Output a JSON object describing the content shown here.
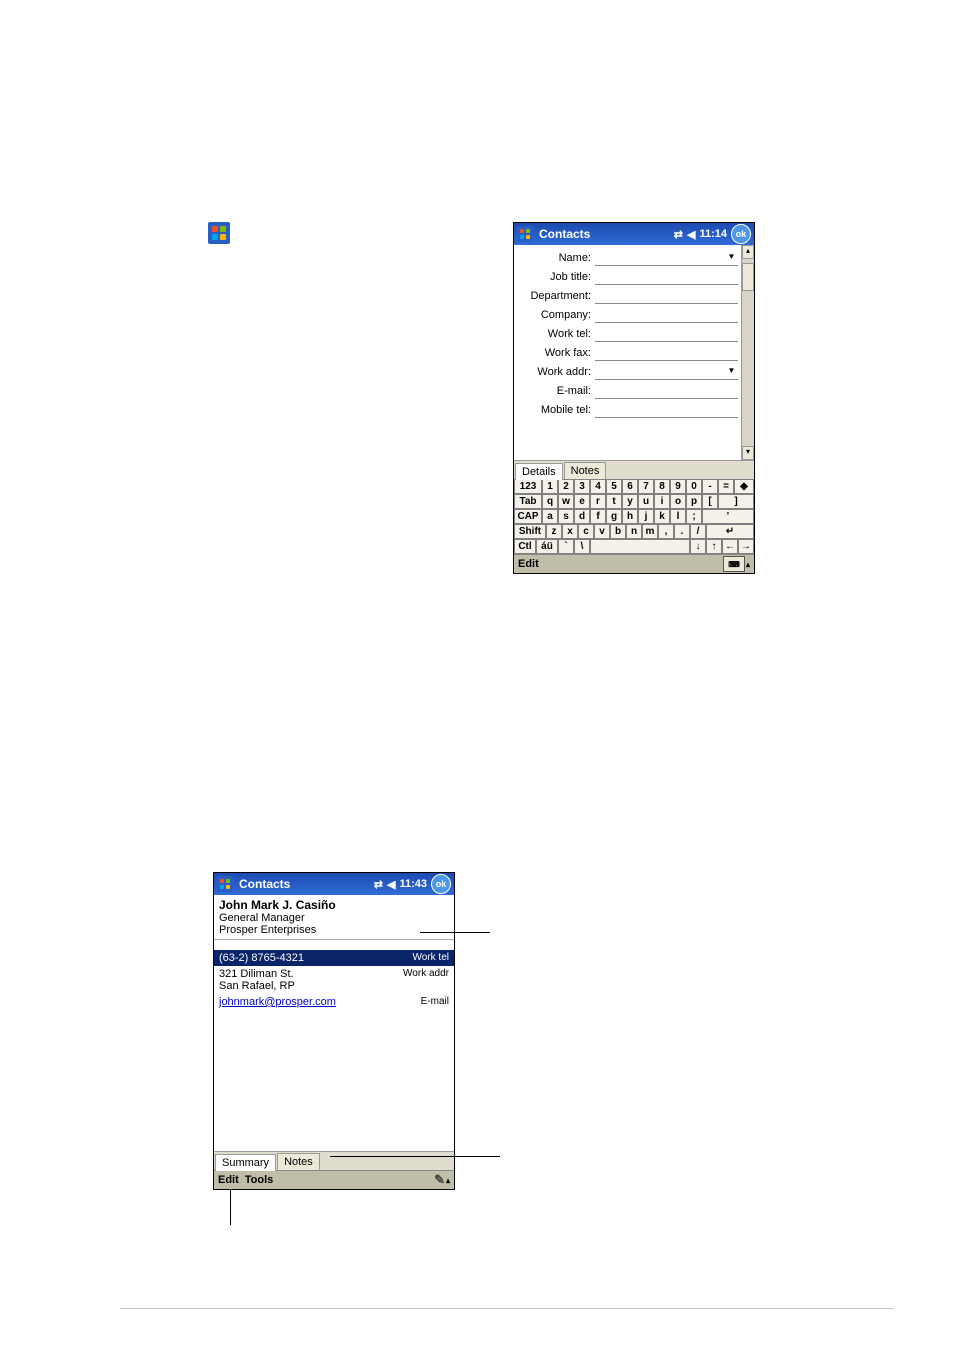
{
  "device1": {
    "title": "Contacts",
    "time": "11:14",
    "ok": "ok",
    "fields": [
      {
        "label": "Name:",
        "dropdown": true
      },
      {
        "label": "Job title:",
        "dropdown": false
      },
      {
        "label": "Department:",
        "dropdown": false
      },
      {
        "label": "Company:",
        "dropdown": false
      },
      {
        "label": "Work tel:",
        "dropdown": false
      },
      {
        "label": "Work fax:",
        "dropdown": false
      },
      {
        "label": "Work addr:",
        "dropdown": true
      },
      {
        "label": "E-mail:",
        "dropdown": false
      },
      {
        "label": "Mobile tel:",
        "dropdown": false
      }
    ],
    "tabs": {
      "details": "Details",
      "notes": "Notes"
    },
    "keyboard": {
      "r1": [
        "123",
        "1",
        "2",
        "3",
        "4",
        "5",
        "6",
        "7",
        "8",
        "9",
        "0",
        "-",
        "=",
        "◆"
      ],
      "r2": [
        "Tab",
        "q",
        "w",
        "e",
        "r",
        "t",
        "y",
        "u",
        "i",
        "o",
        "p",
        "[",
        "]"
      ],
      "r3": [
        "CAP",
        "a",
        "s",
        "d",
        "f",
        "g",
        "h",
        "j",
        "k",
        "l",
        ";",
        "'"
      ],
      "r4": [
        "Shift",
        "z",
        "x",
        "c",
        "v",
        "b",
        "n",
        "m",
        ",",
        ".",
        "/",
        "↵"
      ],
      "r5": [
        "Ctl",
        "áü",
        "`",
        "\\",
        "space",
        "↓",
        "↑",
        "←",
        "→"
      ]
    },
    "menu": {
      "edit": "Edit"
    }
  },
  "device2": {
    "title": "Contacts",
    "time": "11:43",
    "ok": "ok",
    "contact": {
      "name": "John Mark J. Casiño",
      "role": "General Manager",
      "company": "Prosper Enterprises"
    },
    "rows": [
      {
        "left": "(63-2) 8765-4321",
        "right": "Work tel",
        "sel": true
      },
      {
        "left": "321 Diliman St.",
        "left2": "San Rafael, RP",
        "right": "Work addr"
      },
      {
        "left": "johnmark@prosper.com",
        "right": "E-mail",
        "link": true
      }
    ],
    "tabs": {
      "summary": "Summary",
      "notes": "Notes"
    },
    "menu": {
      "edit": "Edit",
      "tools": "Tools"
    }
  }
}
